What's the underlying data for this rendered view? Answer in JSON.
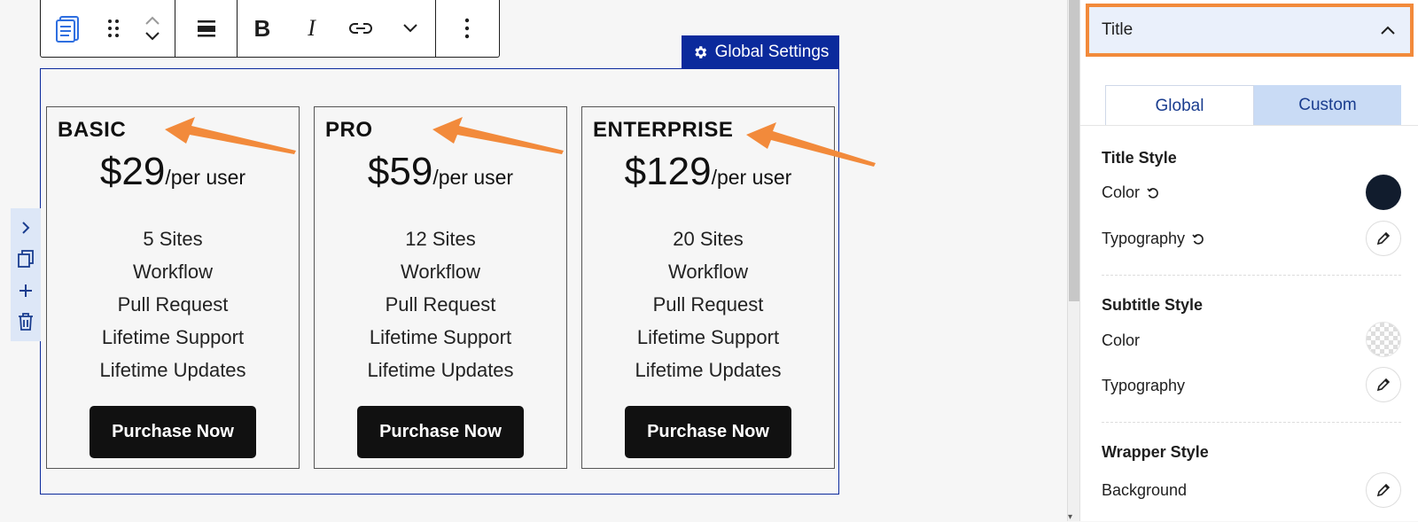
{
  "toolbar": {
    "icons": [
      "block-icon",
      "drag-handle-icon",
      "move-up-icon",
      "move-down-icon",
      "align-icon",
      "bold-icon",
      "italic-icon",
      "link-icon",
      "more-formatting-icon",
      "options-icon"
    ],
    "bold_label": "B",
    "italic_label": "I"
  },
  "global_settings": {
    "label": "Global Settings"
  },
  "side_tools": [
    "expand-icon",
    "copy-icon",
    "add-icon",
    "delete-icon"
  ],
  "plans": [
    {
      "title": "BASIC",
      "price": "$29",
      "period": "/per user",
      "features": [
        "5 Sites",
        "Workflow",
        "Pull Request",
        "Lifetime Support",
        "Lifetime Updates"
      ],
      "button": "Purchase Now"
    },
    {
      "title": "PRO",
      "price": "$59",
      "period": "/per user",
      "features": [
        "12 Sites",
        "Workflow",
        "Pull Request",
        "Lifetime Support",
        "Lifetime Updates"
      ],
      "button": "Purchase Now"
    },
    {
      "title": "ENTERPRISE",
      "price": "$129",
      "period": "/per user",
      "features": [
        "20 Sites",
        "Workflow",
        "Pull Request",
        "Lifetime Support",
        "Lifetime Updates"
      ],
      "button": "Purchase Now"
    }
  ],
  "sidebar": {
    "panel_title": "Title",
    "tabs": [
      {
        "label": "Global"
      },
      {
        "label": "Custom"
      }
    ],
    "title_style": {
      "heading": "Title Style",
      "color_label": "Color",
      "typography_label": "Typography",
      "color": "#111c2d"
    },
    "subtitle_style": {
      "heading": "Subtitle Style",
      "color_label": "Color",
      "typography_label": "Typography"
    },
    "wrapper_style": {
      "heading": "Wrapper Style",
      "background_label": "Background"
    }
  },
  "colors": {
    "accent": "#0b2a9c",
    "highlight": "#f28a3b",
    "tab_active_bg": "#c9dbf5"
  }
}
